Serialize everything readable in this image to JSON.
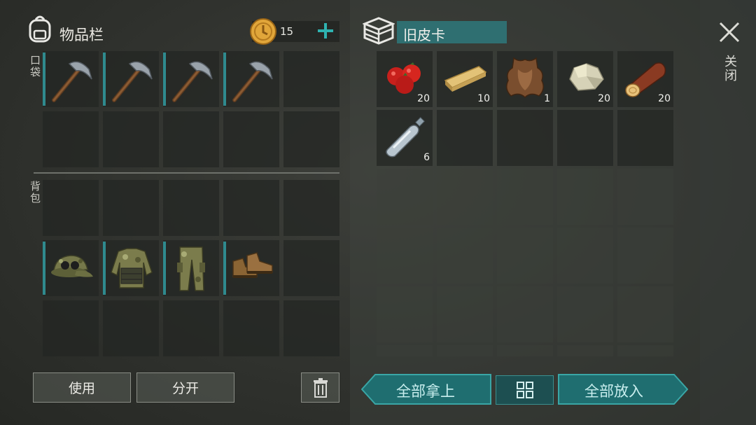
{
  "inventory": {
    "title": "物品栏",
    "coins": "15",
    "pocket_label": "口袋",
    "backpack_label": "背包"
  },
  "container": {
    "name": "旧皮卡",
    "items": [
      {
        "icon": "tomato-icon",
        "qty": "20"
      },
      {
        "icon": "wooden-plank-icon",
        "qty": "10"
      },
      {
        "icon": "leather-hide-icon",
        "qty": "1"
      },
      {
        "icon": "stone-icon",
        "qty": "20"
      },
      {
        "icon": "log-icon",
        "qty": "20"
      },
      {
        "icon": "water-bottle-icon",
        "qty": "6"
      }
    ]
  },
  "close_label": "关闭",
  "buttons": {
    "use": "使用",
    "split": "分开",
    "take_all": "全部拿上",
    "put_all": "全部放入"
  },
  "colors": {
    "teal": "#2f8a8e",
    "slot_bg": "#222522"
  }
}
